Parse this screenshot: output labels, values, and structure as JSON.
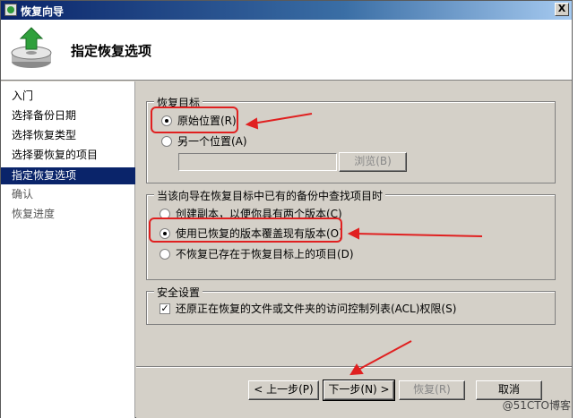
{
  "window": {
    "title": "恢复向导",
    "close_symbol": "X"
  },
  "header": {
    "page_title": "指定恢复选项"
  },
  "nav": {
    "items": [
      {
        "label": "入门",
        "state": "done"
      },
      {
        "label": "选择备份日期",
        "state": "done"
      },
      {
        "label": "选择恢复类型",
        "state": "done"
      },
      {
        "label": "选择要恢复的项目",
        "state": "done"
      },
      {
        "label": "指定恢复选项",
        "state": "active"
      },
      {
        "label": "确认",
        "state": "pending"
      },
      {
        "label": "恢复进度",
        "state": "pending"
      }
    ]
  },
  "recovery_target": {
    "legend": "恢复目标",
    "option_original": "原始位置(R)",
    "option_other": "另一个位置(A)",
    "path_value": "",
    "browse_label": "浏览(B)"
  },
  "existing_items": {
    "legend": "当该向导在恢复目标中已有的备份中查找项目时",
    "option_copy": "创建副本，以便你具有两个版本(C)",
    "option_overwrite": "使用已恢复的版本覆盖现有版本(O)",
    "option_skip": "不恢复已存在于恢复目标上的项目(D)"
  },
  "security": {
    "legend": "安全设置",
    "restore_acl_label": "还原正在恢复的文件或文件夹的访问控制列表(ACL)权限(S)",
    "restore_acl_checked": true
  },
  "footer": {
    "back_label": "< 上一步(P)",
    "next_label": "下一步(N) >",
    "recover_label": "恢复(R)",
    "cancel_label": "取消"
  },
  "watermark": "@51CTO博客",
  "colors": {
    "annotation": "#e02020",
    "active_nav": "#0a246a",
    "dialog_bg": "#d4d0c8"
  }
}
